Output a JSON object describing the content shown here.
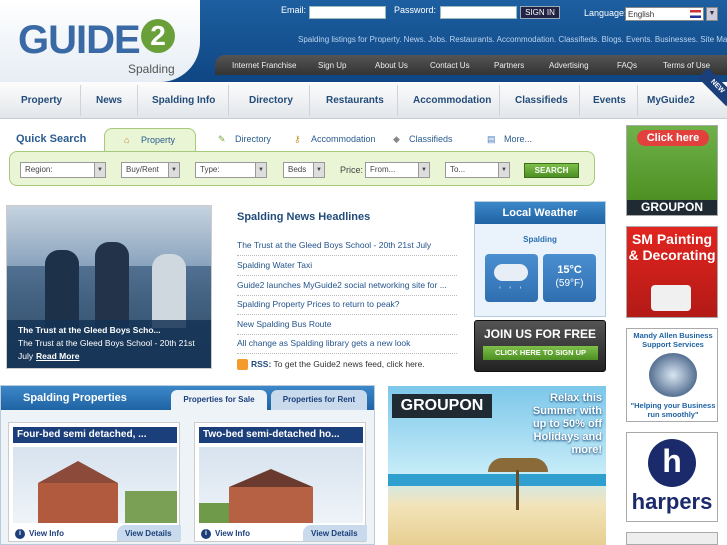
{
  "header": {
    "logo": "GUIDE",
    "logo_number": "2",
    "logo_sub": "Spalding",
    "email_label": "Email:",
    "password_label": "Password:",
    "signin": "SIGN IN",
    "language_label": "Language:",
    "language_value": "English",
    "tagline": "Spalding listings for Property. News. Jobs. Restaurants. Accommodation. Classifieds. Blogs. Events. Businesses. Site Map"
  },
  "top_nav": [
    "Internet Franchise",
    "Sign Up",
    "About Us",
    "Contact Us",
    "Partners",
    "Advertising",
    "FAQs",
    "Terms of Use"
  ],
  "main_nav": [
    "Property",
    "News",
    "Spalding Info",
    "Directory",
    "Restaurants",
    "Accommodation",
    "Classifieds",
    "Events",
    "MyGuide2"
  ],
  "main_nav_new": "NEW",
  "quick_search": {
    "title": "Quick Search",
    "tabs": [
      "Property",
      "Directory",
      "Accommodation",
      "Classifieds",
      "More..."
    ],
    "fields": [
      "Region:",
      "Buy/Rent",
      "Type:",
      "Beds"
    ],
    "price_label": "Price:",
    "price_from": "From...",
    "price_to": "To...",
    "search": "SEARCH"
  },
  "feature": {
    "caption_title": "The Trust at the Gleed Boys Scho...",
    "caption_text": "The Trust at the Gleed Boys School - 20th 21st July",
    "read_more": "Read More"
  },
  "news": {
    "title": "Spalding News Headlines",
    "items": [
      "The Trust at the Gleed Boys School - 20th 21st July",
      "Spalding Water Taxi",
      "Guide2 launches MyGuide2 social networking site for ...",
      "Spalding Property Prices to return to peak?",
      "New Spalding Bus Route",
      "All change as Spalding library gets a new look"
    ],
    "rss_label": "RSS:",
    "rss_text": "To get the Guide2 news feed, click here."
  },
  "weather": {
    "title": "Local Weather",
    "place": "Spalding",
    "temp_c": "15°C",
    "temp_f": "(59°F)"
  },
  "join": {
    "title": "JOIN US FOR FREE",
    "button": "CLICK HERE TO SIGN UP"
  },
  "properties": {
    "title": "Spalding Properties",
    "tabs": [
      "Properties for Sale",
      "Properties for Rent"
    ],
    "cards": [
      {
        "title": "Four-bed semi detached, ...",
        "info": "View Info",
        "details": "View Details"
      },
      {
        "title": "Two-bed semi-detached ho...",
        "info": "View Info",
        "details": "View Details"
      }
    ]
  },
  "ads": {
    "groupon_big": {
      "brand": "GROUPON",
      "headline": "Relax this Summer with up to 50% off Holidays and more!"
    },
    "side": [
      {
        "top": "Click here",
        "brand": "GROUPON"
      },
      {
        "text": "SM Painting & Decorating"
      },
      {
        "title": "Mandy Allen Business Support Services",
        "slogan": "\"Helping your Business run smoothly\""
      },
      {
        "brand": "harpers",
        "letter": "h"
      }
    ]
  },
  "colors": {
    "brand_blue": "#1f63a3",
    "green": "#6aa03a",
    "nav_text": "#234c7a"
  }
}
